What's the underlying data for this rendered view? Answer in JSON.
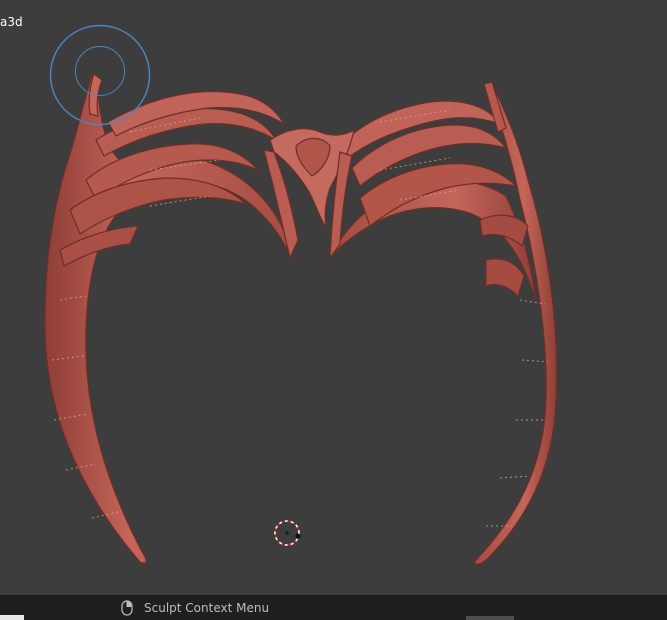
{
  "viewport": {
    "label": "a3d",
    "model": "crown-sculpt"
  },
  "colors": {
    "background": "#3d3d3d",
    "model": "#b6574d",
    "brush_ring": "#4b86c4",
    "statusbar": "#1f1f1f"
  },
  "statusbar": {
    "hint": "Sculpt Context Menu",
    "hint_icon": "mouse-right-click-icon"
  }
}
